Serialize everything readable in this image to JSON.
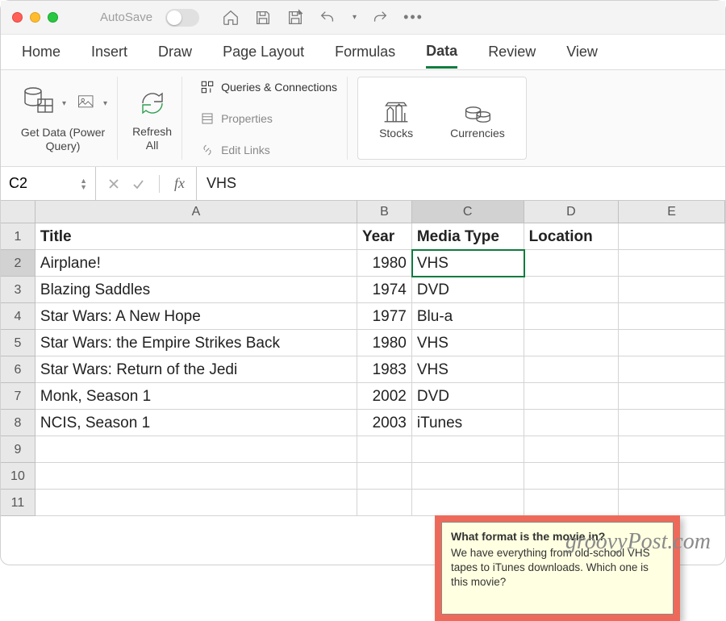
{
  "titlebar": {
    "autosave_label": "AutoSave"
  },
  "tabs": [
    "Home",
    "Insert",
    "Draw",
    "Page Layout",
    "Formulas",
    "Data",
    "Review",
    "View"
  ],
  "active_tab": "Data",
  "ribbon": {
    "get_data_label": "Get Data (Power\nQuery)",
    "refresh_label": "Refresh\nAll",
    "qc_label": "Queries & Connections",
    "props_label": "Properties",
    "edit_links_label": "Edit Links",
    "stocks_label": "Stocks",
    "currencies_label": "Currencies"
  },
  "formula_bar": {
    "name_box": "C2",
    "fx_label": "fx",
    "value": "VHS"
  },
  "columns": [
    "A",
    "B",
    "C",
    "D",
    "E"
  ],
  "row_numbers": [
    "1",
    "2",
    "3",
    "4",
    "5",
    "6",
    "7",
    "8",
    "9",
    "10",
    "11"
  ],
  "headers": {
    "A": "Title",
    "B": "Year",
    "C": "Media Type",
    "D": "Location"
  },
  "data": [
    {
      "A": "Airplane!",
      "B": "1980",
      "C": "VHS"
    },
    {
      "A": "Blazing Saddles",
      "B": "1974",
      "C": "DVD"
    },
    {
      "A": "Star Wars: A New Hope",
      "B": "1977",
      "C": "Blu-a"
    },
    {
      "A": "Star Wars: the Empire Strikes Back",
      "B": "1980",
      "C": "VHS"
    },
    {
      "A": "Star Wars: Return of the Jedi",
      "B": "1983",
      "C": "VHS"
    },
    {
      "A": "Monk, Season 1",
      "B": "2002",
      "C": "DVD"
    },
    {
      "A": "NCIS, Season 1",
      "B": "2003",
      "C": "iTunes"
    }
  ],
  "comment": {
    "title": "What format is the movie in?",
    "body": "We have everything from old-school VHS tapes to iTunes downloads. Which one is this movie?"
  },
  "watermark": "groovyPost.com"
}
